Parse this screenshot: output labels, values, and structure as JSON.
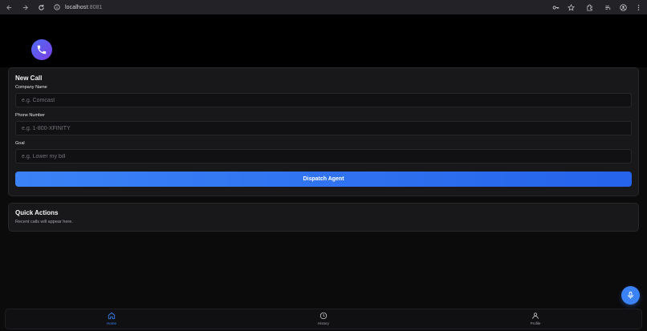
{
  "browser": {
    "url_host": "localhost",
    "url_port": ":8081"
  },
  "colors": {
    "accent": "#3b82f6",
    "background": "#0b0b0c",
    "card": "#18181b"
  },
  "icons": {
    "logo": "phone-icon",
    "fab": "microphone-icon",
    "nav_home": "home-icon",
    "nav_history": "clock-icon",
    "nav_profile": "user-icon"
  },
  "new_call": {
    "title": "New Call",
    "company_label": "Company Name",
    "company_placeholder": "e.g. Comcast",
    "phone_label": "Phone Number",
    "phone_placeholder": "e.g. 1-800-XFINITY",
    "goal_label": "Goal",
    "goal_placeholder": "e.g. Lower my bill",
    "dispatch_label": "Dispatch Agent"
  },
  "quick_actions": {
    "title": "Quick Actions",
    "subtitle": "Recent calls will appear here."
  },
  "bottom_nav": {
    "items": [
      {
        "label": "Home",
        "active": true
      },
      {
        "label": "History",
        "active": false
      },
      {
        "label": "Profile",
        "active": false
      }
    ]
  }
}
